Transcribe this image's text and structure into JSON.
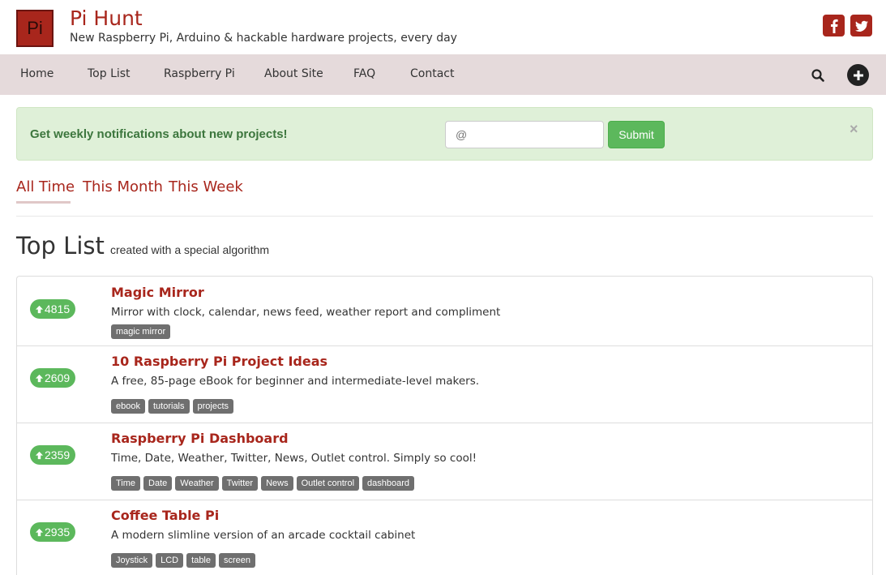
{
  "site": {
    "logo_text": "Pi",
    "title": "Pi Hunt",
    "tagline": "New Raspberry Pi, Arduino & hackable hardware projects, every day",
    "brand_color": "#a8261c",
    "social": [
      {
        "name": "facebook-icon"
      },
      {
        "name": "twitter-icon"
      }
    ]
  },
  "nav": {
    "items": [
      {
        "label": "Home"
      },
      {
        "label": "Top List"
      },
      {
        "label": "Raspberry Pi"
      },
      {
        "label": "About Site"
      },
      {
        "label": "FAQ"
      },
      {
        "label": "Contact"
      }
    ],
    "search_icon": "search-icon",
    "add_icon": "plus-circle-icon"
  },
  "alert": {
    "text": "Get weekly notifications about new projects!",
    "input_placeholder": "@",
    "input_value": "",
    "submit_label": "Submit",
    "close_label": "×",
    "color": "#dff0d8"
  },
  "tabs": {
    "items": [
      {
        "label": "All Time",
        "active": true
      },
      {
        "label": "This Month",
        "active": false
      },
      {
        "label": "This Week",
        "active": false
      }
    ]
  },
  "heading": {
    "title": "Top List",
    "subtitle": "created with a special algorithm"
  },
  "projects": [
    {
      "votes": "4815",
      "title": "Magic Mirror",
      "description": "Mirror with clock, calendar, news feed, weather report and compliment",
      "tags": [
        "magic mirror"
      ]
    },
    {
      "votes": "2609",
      "title": "10 Raspberry Pi Project Ideas",
      "description": "A free, 85-page eBook for beginner and intermediate-level makers.",
      "tags": [
        "ebook",
        "tutorials",
        "projects"
      ]
    },
    {
      "votes": "2359",
      "title": "Raspberry Pi Dashboard",
      "description": "Time, Date, Weather, Twitter, News, Outlet control. Simply so cool!",
      "tags": [
        "Time",
        "Date",
        "Weather",
        "Twitter",
        "News",
        "Outlet control",
        "dashboard"
      ]
    },
    {
      "votes": "2935",
      "title": "Coffee Table Pi",
      "description": "A modern slimline version of an arcade cocktail cabinet",
      "tags": [
        "Joystick",
        "LCD",
        "table",
        "screen"
      ]
    }
  ]
}
